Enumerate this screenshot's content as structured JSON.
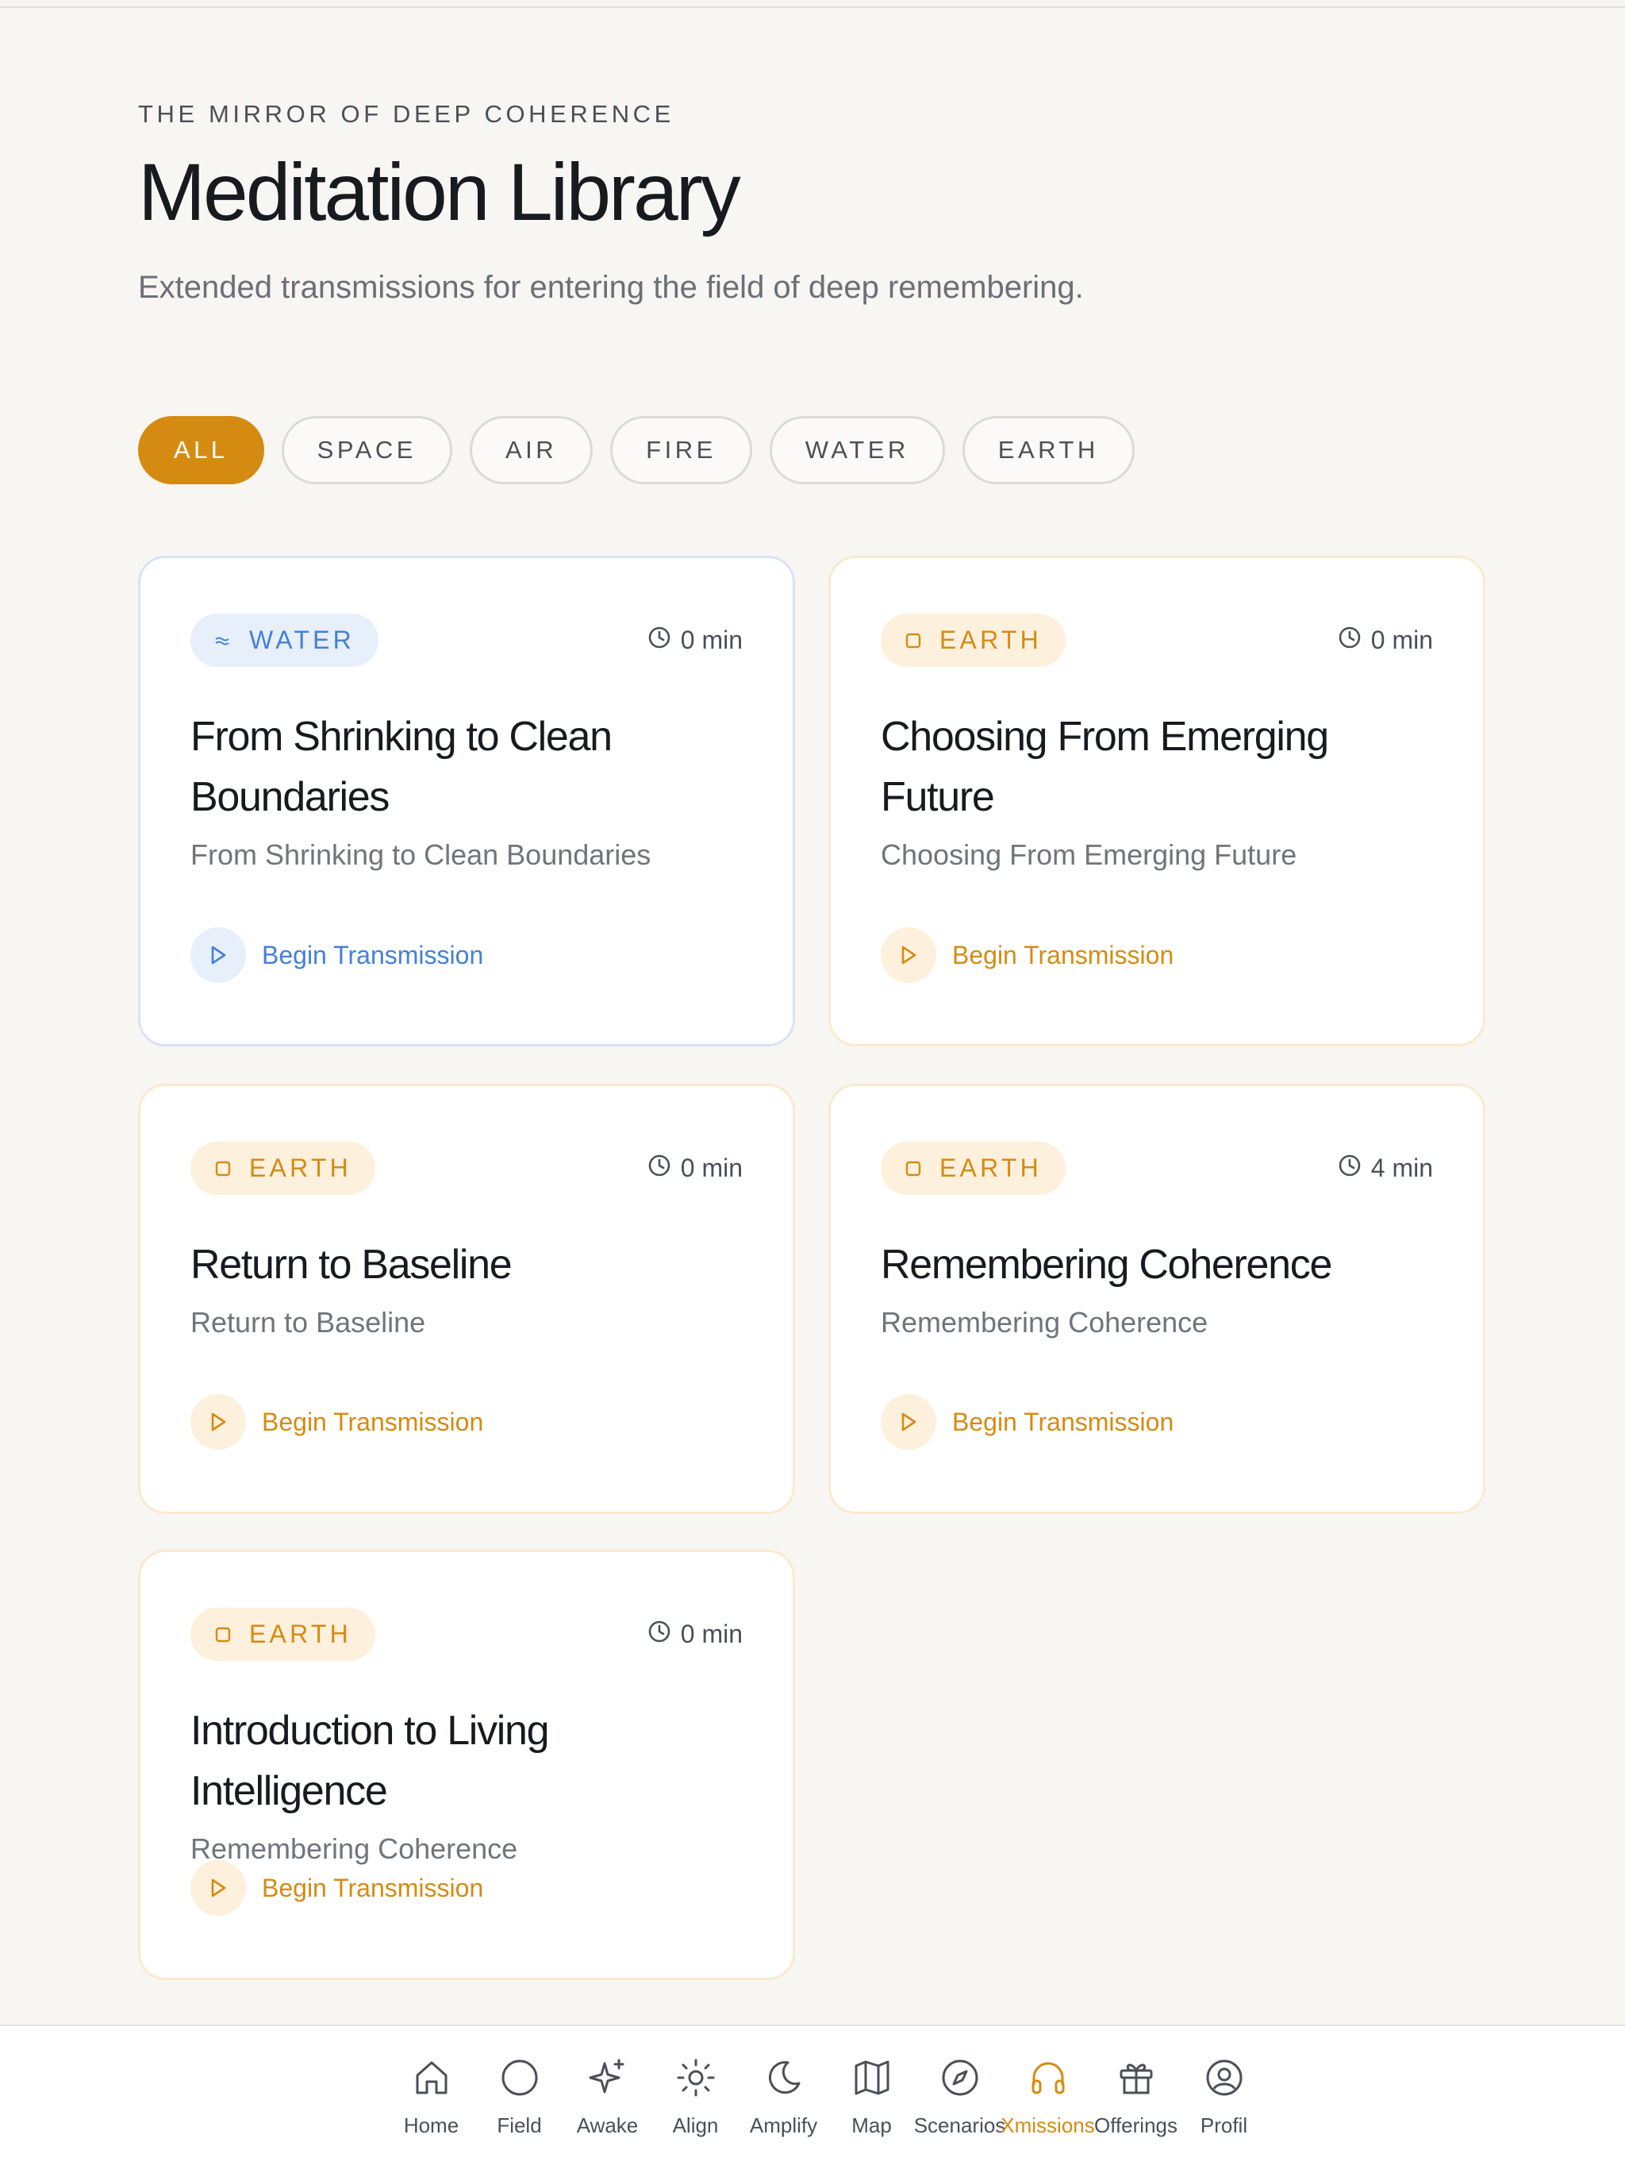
{
  "header": {
    "eyebrow": "THE MIRROR OF DEEP COHERENCE",
    "title": "Meditation Library",
    "subtitle": "Extended transmissions for entering the field of deep remembering."
  },
  "filters": [
    "ALL",
    "SPACE",
    "AIR",
    "FIRE",
    "WATER",
    "EARTH"
  ],
  "active_filter": "ALL",
  "cards": [
    {
      "element": "WATER",
      "icon": "water-wave-icon",
      "duration": "0 min",
      "title": "From Shrinking to Clean Boundaries",
      "subtitle": "From Shrinking to Clean Boundaries",
      "action": "Begin Transmission"
    },
    {
      "element": "EARTH",
      "icon": "earth-square-icon",
      "duration": "0 min",
      "title": "Choosing From Emerging Future",
      "subtitle": "Choosing From Emerging Future",
      "action": "Begin Transmission"
    },
    {
      "element": "EARTH",
      "icon": "earth-square-icon",
      "duration": "0 min",
      "title": "Return to Baseline",
      "subtitle": "Return to Baseline",
      "action": "Begin Transmission"
    },
    {
      "element": "EARTH",
      "icon": "earth-square-icon",
      "duration": "4 min",
      "title": "Remembering Coherence",
      "subtitle": "Remembering Coherence",
      "action": "Begin Transmission"
    },
    {
      "element": "EARTH",
      "icon": "earth-square-icon",
      "duration": "0 min",
      "title": "Introduction to Living Intelligence",
      "subtitle": "Remembering Coherence",
      "action": "Begin Transmission"
    }
  ],
  "nav": [
    {
      "label": "Home",
      "icon": "home-icon"
    },
    {
      "label": "Field",
      "icon": "circle-icon"
    },
    {
      "label": "Awake",
      "icon": "sparkles-icon"
    },
    {
      "label": "Align",
      "icon": "sun-icon"
    },
    {
      "label": "Amplify",
      "icon": "moon-icon"
    },
    {
      "label": "Map",
      "icon": "map-icon"
    },
    {
      "label": "Scenarios",
      "icon": "compass-icon"
    },
    {
      "label": "Xmissions",
      "icon": "headphones-icon"
    },
    {
      "label": "Offerings",
      "icon": "gift-icon"
    },
    {
      "label": "Profil",
      "icon": "user-circle-icon"
    }
  ],
  "active_nav": "Xmissions",
  "colors": {
    "accent": "#d58b12",
    "water": "#4281d8",
    "background": "#f7f6f3"
  }
}
